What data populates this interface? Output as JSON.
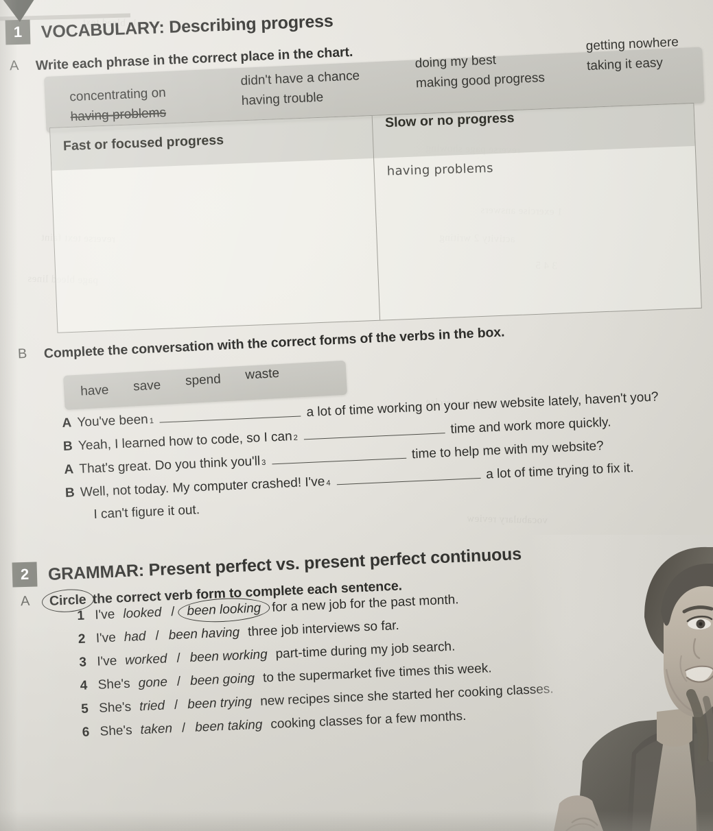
{
  "page": {
    "background_color": "#e6e4de",
    "accent_badge_color": "#75766e",
    "highlight_box_color": "#c6c5be"
  },
  "sections": [
    {
      "number": "1",
      "title": "VOCABULARY: Describing progress",
      "tasks": [
        {
          "letter": "A",
          "instruction": "Write each phrase in the correct place in the chart."
        },
        {
          "letter": "B",
          "instruction": "Complete the conversation with the correct forms of the verbs in the box."
        }
      ]
    },
    {
      "number": "2",
      "title": "GRAMMAR: Present perfect vs. present perfect continuous",
      "tasks": [
        {
          "letter": "A",
          "instruction_circled_word": "Circle",
          "instruction_rest": "the correct verb form to complete each sentence."
        }
      ]
    }
  ],
  "phrase_box": {
    "columns": [
      [
        {
          "text": "concentrating on",
          "used": false
        },
        {
          "text": "having problems",
          "used": true
        }
      ],
      [
        {
          "text": "didn't have a chance",
          "used": false
        },
        {
          "text": "having trouble",
          "used": false
        }
      ],
      [
        {
          "text": "doing my best",
          "used": false
        },
        {
          "text": "making good progress",
          "used": false
        }
      ],
      [
        {
          "text": "getting nowhere",
          "used": false
        },
        {
          "text": "taking it easy",
          "used": false
        }
      ]
    ]
  },
  "chart": {
    "headers": [
      "Fast or focused progress",
      "Slow or no progress"
    ],
    "cells": [
      {
        "column": "Fast or focused progress",
        "answers": []
      },
      {
        "column": "Slow or no progress",
        "answers": [
          "having problems"
        ]
      }
    ],
    "left_answer": "",
    "right_answer": "having problems"
  },
  "verb_box": {
    "verbs": [
      "have",
      "save",
      "spend",
      "waste"
    ]
  },
  "conversation": [
    {
      "speaker": "A",
      "before": "You've been",
      "blank_number": "1",
      "after": "a lot of time working on your new website lately, haven't you?"
    },
    {
      "speaker": "B",
      "before": "Yeah, I learned how to code, so I can",
      "blank_number": "2",
      "after": "time and work more quickly."
    },
    {
      "speaker": "A",
      "before": "That's great. Do you think you'll",
      "blank_number": "3",
      "after": "time to help me with my website?"
    },
    {
      "speaker": "B",
      "before": "Well, not today. My computer crashed! I've",
      "blank_number": "4",
      "after": "a lot of time trying to fix it.",
      "continuation": "I can't figure it out."
    }
  ],
  "grammar_items": [
    {
      "number": "1",
      "before": "I've",
      "option_a": "looked",
      "option_b": "been looking",
      "circled": "b",
      "after": "for a new job for the past month."
    },
    {
      "number": "2",
      "before": "I've",
      "option_a": "had",
      "option_b": "been having",
      "circled": "none",
      "after": "three job interviews so far."
    },
    {
      "number": "3",
      "before": "I've",
      "option_a": "worked",
      "option_b": "been working",
      "circled": "none",
      "after": "part-time during my job search."
    },
    {
      "number": "4",
      "before": "She's",
      "option_a": "gone",
      "option_b": "been going",
      "circled": "none",
      "after": "to the supermarket five times this week."
    },
    {
      "number": "5",
      "before": "She's",
      "option_a": "tried",
      "option_b": "been trying",
      "circled": "none",
      "after": "new recipes since she started her cooking classes."
    },
    {
      "number": "6",
      "before": "She's",
      "option_a": "taken",
      "option_b": "been taking",
      "circled": "none",
      "after": "cooking classes for a few months."
    }
  ],
  "photo": {
    "description": "smiling woman in dark blazer"
  }
}
